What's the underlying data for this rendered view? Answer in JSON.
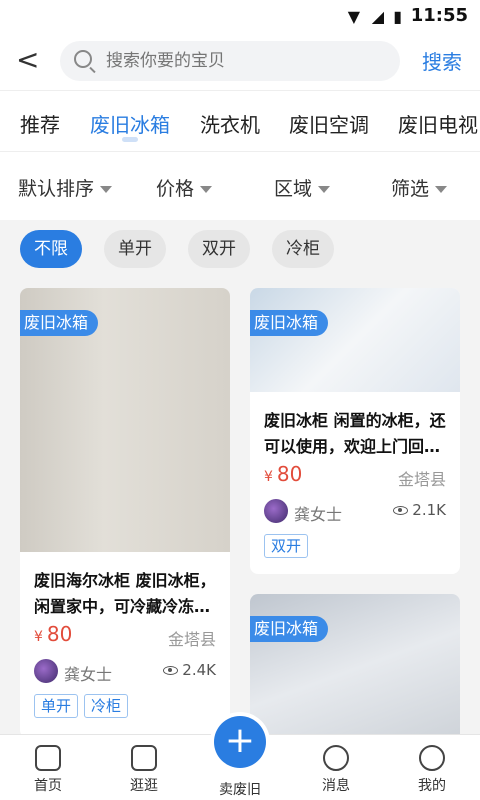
{
  "status": {
    "time": "11:55"
  },
  "header": {
    "search_placeholder": "搜索你要的宝贝",
    "search_label": "搜索"
  },
  "tabs": [
    "推荐",
    "废旧冰箱",
    "洗衣机",
    "废旧空调",
    "废旧电视"
  ],
  "filters": [
    "默认排序",
    "价格",
    "区域",
    "筛选"
  ],
  "chips": [
    "不限",
    "单开",
    "双开",
    "冷柜"
  ],
  "cards": [
    {
      "badge": "废旧冰箱",
      "title": "废旧海尔冰柜 废旧冰柜，闲置家中，可冷藏冷冻…",
      "price_symbol": "¥",
      "price": "80",
      "location": "金塔县",
      "user": "龚女士",
      "views": "2.4K",
      "tags": [
        "单开",
        "冷柜"
      ]
    },
    {
      "badge": "废旧冰箱",
      "title": "废旧冰柜 闲置的冰柜，还可以使用，欢迎上门回…",
      "price_symbol": "¥",
      "price": "80",
      "location": "金塔县",
      "user": "龚女士",
      "views": "2.1K",
      "tags": [
        "双开"
      ]
    },
    {
      "badge": "废旧冰箱"
    }
  ],
  "nav": [
    "首页",
    "逛逛",
    "卖废旧",
    "消息",
    "我的"
  ],
  "colors": {
    "accent": "#2a7de1",
    "price": "#e24c3b"
  }
}
